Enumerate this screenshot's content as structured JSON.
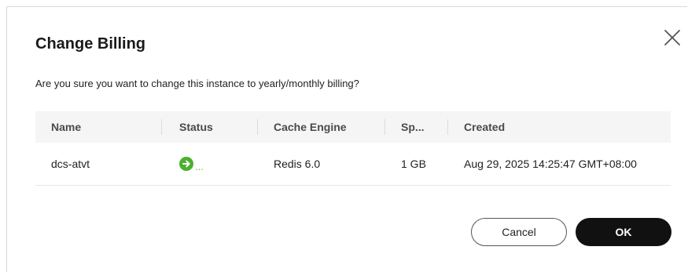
{
  "dialog": {
    "title": "Change Billing",
    "message": "Are you sure you want to change this instance to yearly/monthly billing?",
    "close_icon": "close-icon"
  },
  "table": {
    "columns": [
      "Name",
      "Status",
      "Cache Engine",
      "Sp...",
      "Created"
    ],
    "rows": [
      {
        "name": "dcs-atvt",
        "status_icon": "arrow-right-circle-icon",
        "status_text": "...",
        "cache_engine": "Redis 6.0",
        "spec": "1 GB",
        "created": "Aug 29, 2025 14:25:47 GMT+08:00"
      }
    ]
  },
  "buttons": {
    "cancel": "Cancel",
    "ok": "OK"
  },
  "colors": {
    "status_green": "#4caf2f",
    "primary_button": "#111111",
    "header_bg": "#f5f5f5"
  }
}
